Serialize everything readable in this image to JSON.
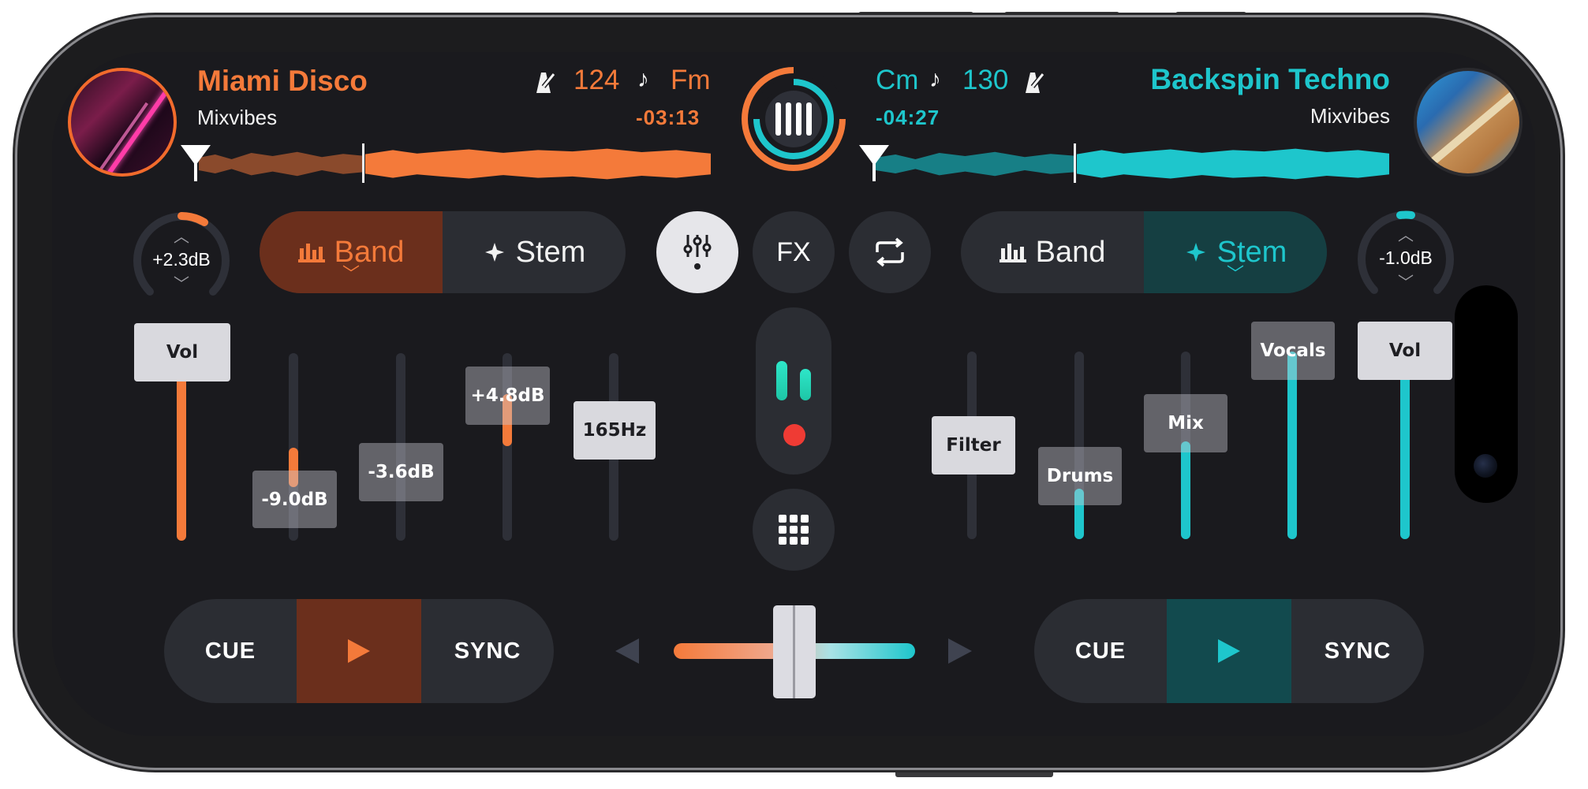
{
  "deck_a": {
    "title": "Miami Disco",
    "artist": "Mixvibes",
    "bpm": "124",
    "key": "Fm",
    "remaining": "-03:13",
    "accent": "#f47a3a",
    "gain": "+2.3dB",
    "mode_band": "Band",
    "mode_stem": "Stem",
    "active_mode": "Band",
    "faders": {
      "vol": "Vol",
      "low": "-9.0dB",
      "mid": "-3.6dB",
      "high": "+4.8dB",
      "filter": "165Hz"
    },
    "cue": "CUE",
    "sync": "SYNC"
  },
  "deck_b": {
    "title": "Backspin Techno",
    "artist": "Mixvibes",
    "bpm": "130",
    "key": "Cm",
    "remaining": "-04:27",
    "accent": "#1ec6cc",
    "gain": "-1.0dB",
    "mode_band": "Band",
    "mode_stem": "Stem",
    "active_mode": "Stem",
    "faders": {
      "filter": "Filter",
      "drums": "Drums",
      "mix": "Mix",
      "vocals": "Vocals",
      "vol": "Vol"
    },
    "cue": "CUE",
    "sync": "SYNC"
  },
  "center": {
    "fx_label": "FX",
    "icons": [
      "mixer-icon",
      "fx-button",
      "loop-icon",
      "grid-icon",
      "record-icon"
    ]
  }
}
